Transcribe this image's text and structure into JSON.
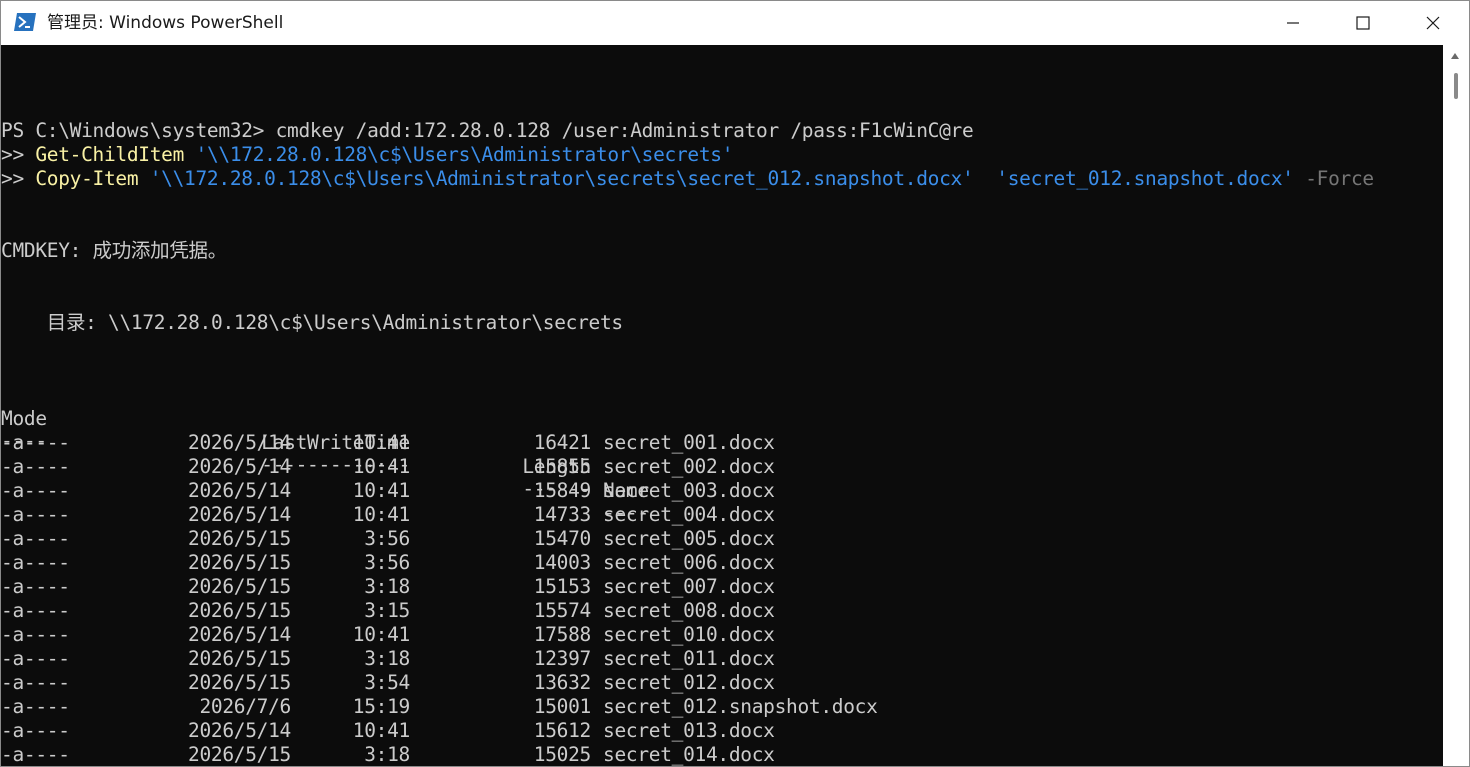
{
  "window": {
    "title": "管理员: Windows PowerShell",
    "controls": {
      "minimize": "─",
      "maximize": "☐",
      "close": "✕"
    }
  },
  "console": {
    "prompt_line": {
      "prompt": "PS C:\\Windows\\system32> ",
      "command": "cmdkey /add:172.28.0.128 /user:Administrator /pass:F1cWinC@re"
    },
    "continuation_1": {
      "marker": ">> ",
      "cmdlet": "Get-ChildItem",
      "arg": " '\\\\172.28.0.128\\c$\\Users\\Administrator\\secrets'"
    },
    "continuation_2": {
      "marker": ">> ",
      "cmdlet": "Copy-Item",
      "arg1": " '\\\\172.28.0.128\\c$\\Users\\Administrator\\secrets\\secret_012.snapshot.docx'",
      "arg2": "  'secret_012.snapshot.docx'",
      "param": " -Force"
    },
    "cmdkey_result": "CMDKEY: 成功添加凭据。",
    "directory_line": "    目录: \\\\172.28.0.128\\c$\\Users\\Administrator\\secrets",
    "table": {
      "headers": {
        "mode": "Mode",
        "lastwrite": "LastWriteTime",
        "length": "Length",
        "name": "Name"
      },
      "underlines": {
        "mode": "----",
        "lastwrite": "-------------",
        "length": "------",
        "name": "----"
      },
      "rows": [
        {
          "mode": "-a----",
          "date": "2026/5/14",
          "time": "10:41",
          "length": "16421",
          "name": "secret_001.docx"
        },
        {
          "mode": "-a----",
          "date": "2026/5/14",
          "time": "10:41",
          "length": "15855",
          "name": "secret_002.docx"
        },
        {
          "mode": "-a----",
          "date": "2026/5/14",
          "time": "10:41",
          "length": "15849",
          "name": "secret_003.docx"
        },
        {
          "mode": "-a----",
          "date": "2026/5/14",
          "time": "10:41",
          "length": "14733",
          "name": "secret_004.docx"
        },
        {
          "mode": "-a----",
          "date": "2026/5/15",
          "time": "3:56",
          "length": "15470",
          "name": "secret_005.docx"
        },
        {
          "mode": "-a----",
          "date": "2026/5/15",
          "time": "3:56",
          "length": "14003",
          "name": "secret_006.docx"
        },
        {
          "mode": "-a----",
          "date": "2026/5/15",
          "time": "3:18",
          "length": "15153",
          "name": "secret_007.docx"
        },
        {
          "mode": "-a----",
          "date": "2026/5/15",
          "time": "3:15",
          "length": "15574",
          "name": "secret_008.docx"
        },
        {
          "mode": "-a----",
          "date": "2026/5/14",
          "time": "10:41",
          "length": "17588",
          "name": "secret_010.docx"
        },
        {
          "mode": "-a----",
          "date": "2026/5/15",
          "time": "3:18",
          "length": "12397",
          "name": "secret_011.docx"
        },
        {
          "mode": "-a----",
          "date": "2026/5/15",
          "time": "3:54",
          "length": "13632",
          "name": "secret_012.docx"
        },
        {
          "mode": "-a----",
          "date": "2026/7/6",
          "time": "15:19",
          "length": "15001",
          "name": "secret_012.snapshot.docx"
        },
        {
          "mode": "-a----",
          "date": "2026/5/14",
          "time": "10:41",
          "length": "15612",
          "name": "secret_013.docx"
        },
        {
          "mode": "-a----",
          "date": "2026/5/15",
          "time": "3:18",
          "length": "15025",
          "name": "secret_014.docx"
        }
      ]
    }
  },
  "colors": {
    "background": "#0c0c0c",
    "text": "#cccccc",
    "cmdlet": "#f9f1a5",
    "string": "#3b8eea",
    "parameter": "#767676"
  },
  "icons": {
    "app": "powershell-icon",
    "minimize": "minimize-icon",
    "maximize": "maximize-icon",
    "close": "close-icon"
  }
}
